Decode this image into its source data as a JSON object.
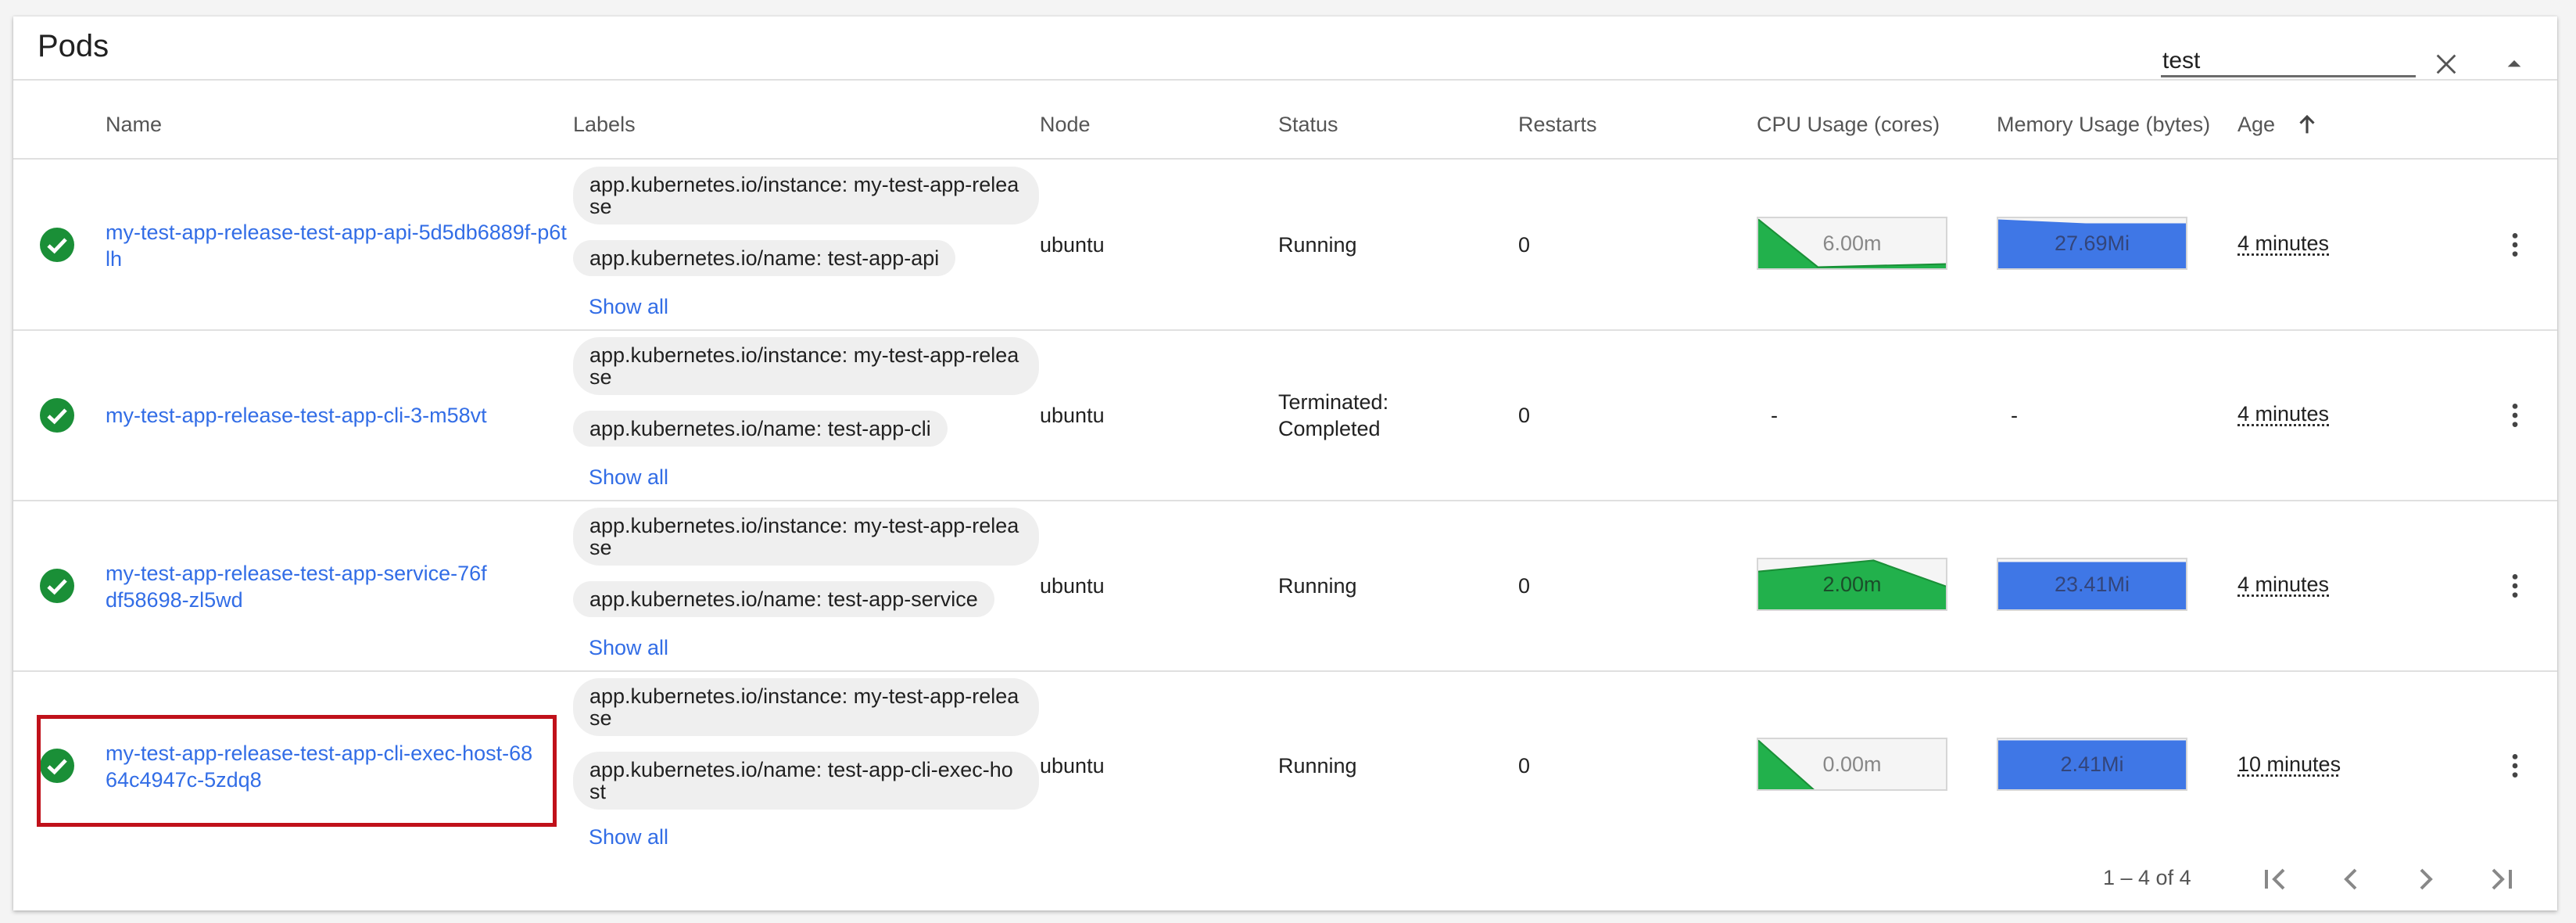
{
  "card": {
    "title": "Pods",
    "search": {
      "value": "test",
      "placeholder": ""
    }
  },
  "columns": [
    "Name",
    "Labels",
    "Node",
    "Status",
    "Restarts",
    "CPU Usage (cores)",
    "Memory Usage (bytes)",
    "Age"
  ],
  "rows": [
    {
      "name": "my-test-app-release-test-app-api-5d5db6889f-p6tlh",
      "labels": [
        "app.kubernetes.io/instance: my-test-app-release",
        "app.kubernetes.io/name: test-app-api"
      ],
      "show_all": "Show all",
      "node": "ubuntu",
      "status": "Running",
      "restarts": "0",
      "cpu": "6.00m",
      "memory": "27.69Mi",
      "age": "4 minutes"
    },
    {
      "name": "my-test-app-release-test-app-cli-3-m58vt",
      "labels": [
        "app.kubernetes.io/instance: my-test-app-release",
        "app.kubernetes.io/name: test-app-cli"
      ],
      "show_all": "Show all",
      "node": "ubuntu",
      "status": "Terminated: Completed",
      "restarts": "0",
      "cpu": "-",
      "memory": "-",
      "age": "4 minutes"
    },
    {
      "name": "my-test-app-release-test-app-service-76fdf58698-zl5wd",
      "labels": [
        "app.kubernetes.io/instance: my-test-app-release",
        "app.kubernetes.io/name: test-app-service"
      ],
      "show_all": "Show all",
      "node": "ubuntu",
      "status": "Running",
      "restarts": "0",
      "cpu": "2.00m",
      "memory": "23.41Mi",
      "age": "4 minutes"
    },
    {
      "name": "my-test-app-release-test-app-cli-exec-host-6864c4947c-5zdq8",
      "labels": [
        "app.kubernetes.io/instance: my-test-app-release",
        "app.kubernetes.io/name: test-app-cli-exec-host"
      ],
      "show_all": "Show all",
      "node": "ubuntu",
      "status": "Running",
      "restarts": "0",
      "cpu": "0.00m",
      "memory": "2.41Mi",
      "age": "10 minutes"
    }
  ],
  "footer": {
    "range": "1 – 4 of 4"
  },
  "colors": {
    "link": "#326de6",
    "success": "#1a8f37",
    "cpu_fill": "#22b14c",
    "mem_fill": "#3f77e6",
    "highlight": "#c0111a"
  },
  "icons": {
    "status": "check-circle-icon",
    "clear": "close-icon",
    "collapse": "arrow-drop-up-icon",
    "sort": "arrow-upward-icon",
    "menu": "more-vert-icon",
    "pager": [
      "first-page-icon",
      "chevron-left-icon",
      "chevron-right-icon",
      "last-page-icon"
    ]
  }
}
